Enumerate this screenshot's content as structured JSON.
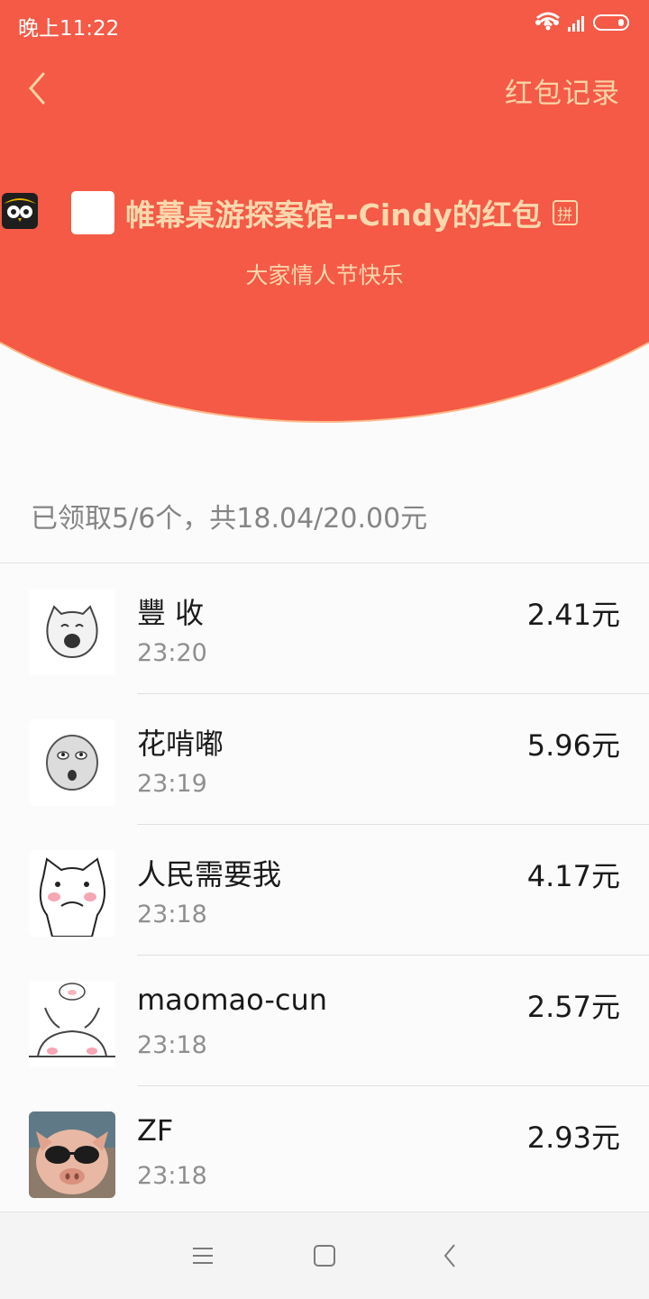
{
  "statusbar": {
    "time": "晚上11:22"
  },
  "header": {
    "records_label": "红包记录",
    "title": "帷幕桌游探案馆--Cindy的红包",
    "pin_badge": "拼",
    "greeting": "大家情人节快乐",
    "bg_color": "#f45a46",
    "accent_color": "#fbd8ad"
  },
  "summary": "已领取5/6个，共18.04/20.00元",
  "records": [
    {
      "name": "豐 收",
      "time": "23:20",
      "amount": "2.41元",
      "avatar": "laughing-face-icon"
    },
    {
      "name": "花啃嘟",
      "time": "23:19",
      "amount": "5.96元",
      "avatar": "surprised-face-icon"
    },
    {
      "name": "人民需要我",
      "time": "23:18",
      "amount": "4.17元",
      "avatar": "cartoon-cat-icon"
    },
    {
      "name": "maomao-cun",
      "time": "23:18",
      "amount": "2.57元",
      "avatar": "cartoon-rabbit-icon"
    },
    {
      "name": "ZF",
      "time": "23:18",
      "amount": "2.93元",
      "avatar": "pig-sunglasses-photo"
    }
  ]
}
